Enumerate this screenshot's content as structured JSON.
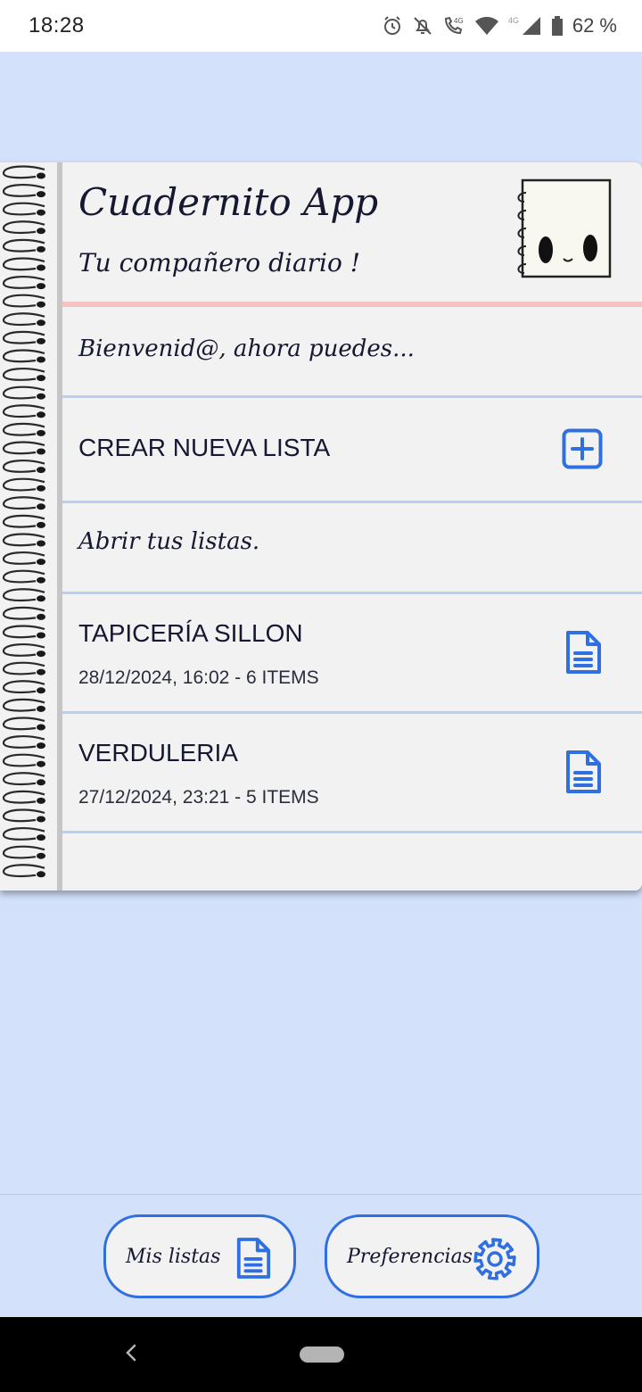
{
  "status_bar": {
    "time": "18:28",
    "battery": "62 %",
    "icons": [
      "alarm-icon",
      "bell-off-icon",
      "volte-call-icon",
      "wifi-icon",
      "signal-4g-icon",
      "battery-icon"
    ]
  },
  "header": {
    "title": "Cuadernito App",
    "subtitle": "Tu compañero diario !",
    "mascot_icon": "notebook-mascot-icon"
  },
  "welcome": {
    "text": "Bienvenid@, ahora puedes..."
  },
  "create": {
    "label": "CREAR NUEVA LISTA",
    "icon": "add-square-icon"
  },
  "open": {
    "text": "Abrir tus listas."
  },
  "lists": [
    {
      "title": "TAPICERÍA SILLON",
      "meta": "28/12/2024, 16:02 - 6 ITEMS",
      "icon": "document-icon"
    },
    {
      "title": "VERDULERIA",
      "meta": "27/12/2024, 23:21 - 5 ITEMS",
      "icon": "document-icon"
    }
  ],
  "bottom_nav": {
    "my_lists_label": "Mis listas",
    "preferences_label": "Preferencias"
  },
  "colors": {
    "background": "#d3e1fb",
    "page": "#f2f2f2",
    "accent": "#2f6fdf",
    "header_rule": "#f6c3c3",
    "row_rule": "#b5d0f2",
    "text": "#151830"
  }
}
